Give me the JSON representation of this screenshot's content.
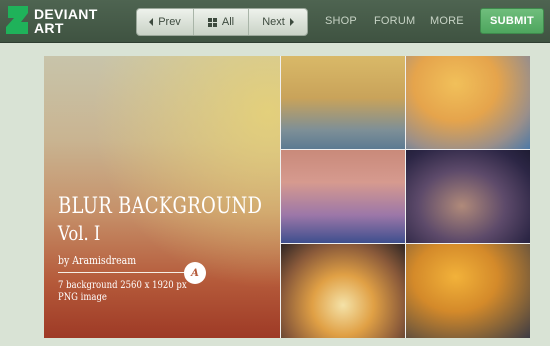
{
  "header": {
    "logo": {
      "line1": "DEVIANT",
      "line2": "ART",
      "icon": "deviantart-logo-icon",
      "brand_color": "#1fb25a"
    },
    "nav": {
      "prev_label": "Prev",
      "all_label": "All",
      "next_label": "Next",
      "icons": [
        "caret-left-icon",
        "grid-icon",
        "caret-right-icon"
      ]
    },
    "links": [
      "SHOP",
      "FORUM",
      "MORE"
    ],
    "submit_label": "SUBMIT",
    "submit_color": "#5cb16a"
  },
  "artwork": {
    "title": "BLUR BACKGROUND",
    "volume": "Vol. I",
    "author": "by Aramisdream",
    "badge": "A",
    "info_line1": "7 background  2560 x 1920 px",
    "info_line2": "PNG image"
  }
}
